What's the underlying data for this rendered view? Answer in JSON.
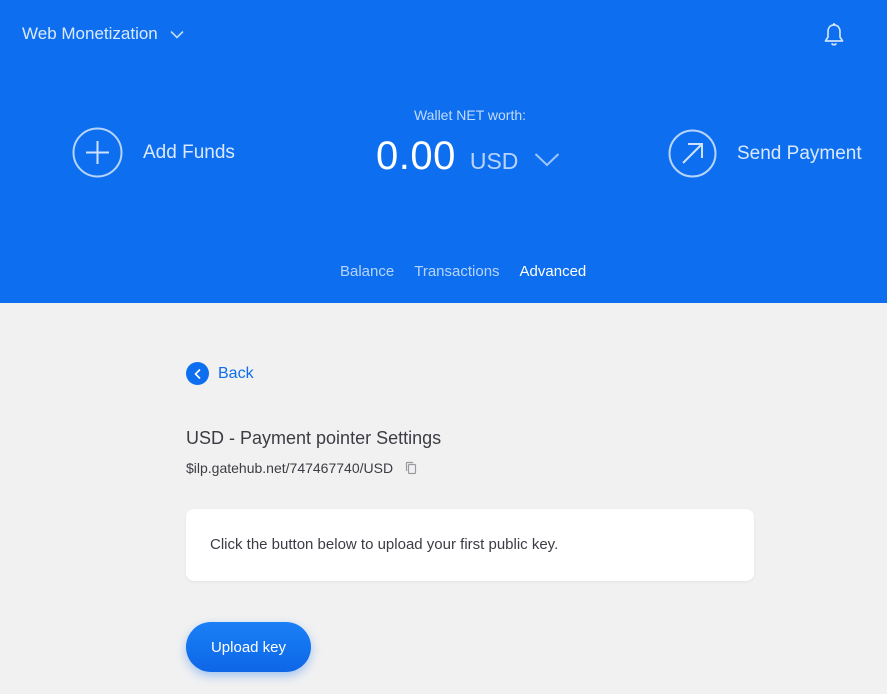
{
  "header": {
    "wallet_name": "Web Monetization",
    "wallet_dropdown_icon": "chevron-down-icon",
    "notifications_icon": "bell-icon",
    "background_color": "#0d6ef0"
  },
  "actions": {
    "add_funds_label": "Add Funds",
    "add_funds_icon": "plus-circle-icon",
    "send_payment_label": "Send Payment",
    "send_payment_icon": "arrow-up-right-circle-icon"
  },
  "networth": {
    "label": "Wallet NET worth:",
    "amount": "0.00",
    "currency": "USD"
  },
  "tabs": [
    {
      "label": "Balance",
      "active": false
    },
    {
      "label": "Transactions",
      "active": false
    },
    {
      "label": "Advanced",
      "active": true
    }
  ],
  "main": {
    "back_label": "Back",
    "back_icon": "chevron-left-icon",
    "title": "USD - Payment pointer Settings",
    "pointer": "$ilp.gatehub.net/747467740/USD",
    "copy_icon": "copy-icon",
    "card_text": "Click the button below to upload your first public key.",
    "upload_button_label": "Upload key",
    "accent_color": "#0d6ef0"
  }
}
